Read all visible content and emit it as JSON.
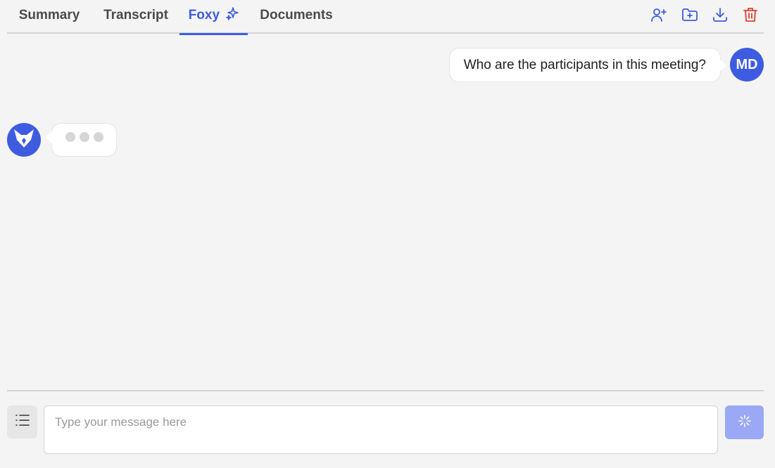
{
  "tabs": {
    "summary": "Summary",
    "transcript": "Transcript",
    "foxy": "Foxy",
    "documents": "Documents",
    "active": "Foxy"
  },
  "toolbar": {
    "icons": [
      "add-user-icon",
      "folder-add-icon",
      "download-icon",
      "trash-icon"
    ]
  },
  "chat": {
    "user_message": "Who are the participants in this meeting?",
    "user_initials": "MD",
    "bot_status": "typing"
  },
  "composer": {
    "placeholder": "Type your message here",
    "value": ""
  },
  "colors": {
    "accent": "#3d5ce0",
    "danger": "#d9412e",
    "send_disabled": "#9aa8f5",
    "background": "#f4f4f4"
  }
}
